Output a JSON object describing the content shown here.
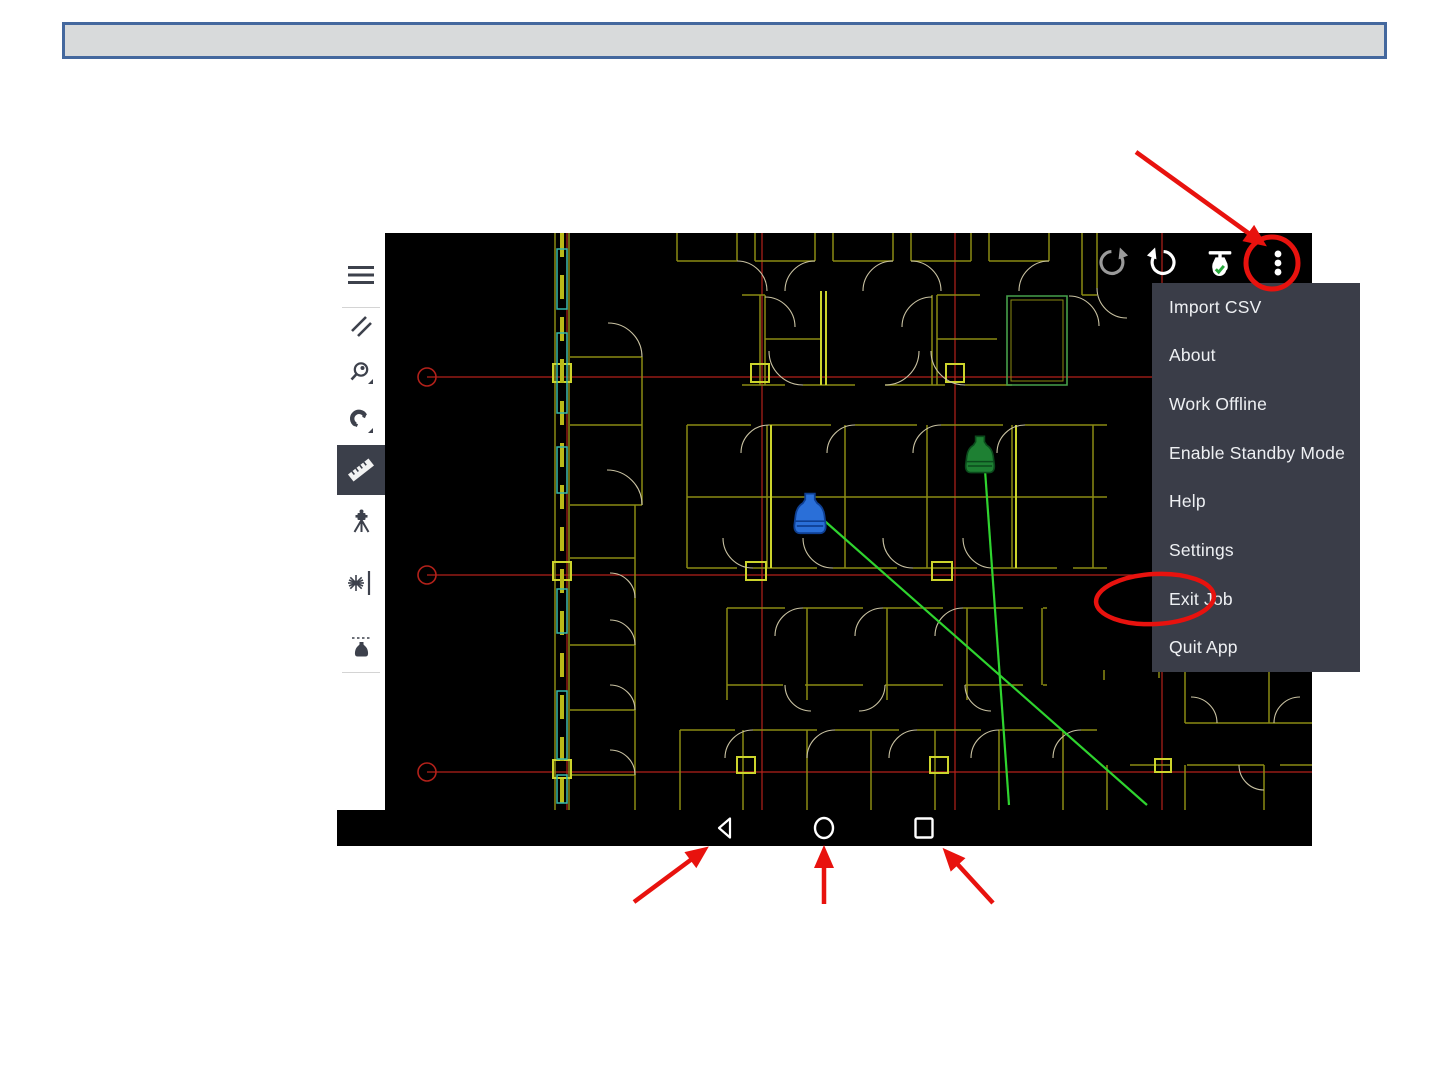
{
  "header_box": {
    "text": ""
  },
  "app": {
    "toolbar": {
      "icons": [
        {
          "name": "redo-icon",
          "state": "disabled"
        },
        {
          "name": "undo-icon",
          "state": "enabled"
        },
        {
          "name": "instrument-check-icon",
          "state": "enabled"
        },
        {
          "name": "overflow-menu-icon",
          "state": "enabled"
        }
      ]
    },
    "menu": {
      "items": [
        "Import CSV",
        "About",
        "Work Offline",
        "Enable Standby Mode",
        "Help",
        "Settings",
        "Exit Job",
        "Quit App"
      ],
      "highlighted_item": "Exit Job"
    },
    "sidebar": {
      "tools": [
        "hamburger-menu",
        "draw-line-tool",
        "zoom-tool",
        "snap-tool",
        "measure-tool",
        "total-station-tool",
        "laser-tool",
        "prism-tool"
      ],
      "selected_tool": "measure-tool"
    },
    "navbar": {
      "buttons": [
        "back",
        "home",
        "recents"
      ]
    },
    "colors": {
      "canvas_bg": "#000000",
      "menu_bg": "#3a3d48",
      "menu_text": "#eef0f3",
      "cad_wall": "#8a8a12",
      "cad_accent": "#ccd42c",
      "cad_cyan": "#35b8ac",
      "cad_grid_red": "#b3211a",
      "measure_line_green": "#2fd42f",
      "prism_blue": "#2a6fd8",
      "prism_green": "#1e8033",
      "annotation_red": "#e8120e"
    }
  },
  "annotations": {
    "items": [
      "arrow-to-overflow-menu",
      "circle-around-overflow-menu",
      "ellipse-around-exit-job",
      "arrow-to-back-button",
      "arrow-to-home-button",
      "arrow-to-recents-button"
    ]
  }
}
